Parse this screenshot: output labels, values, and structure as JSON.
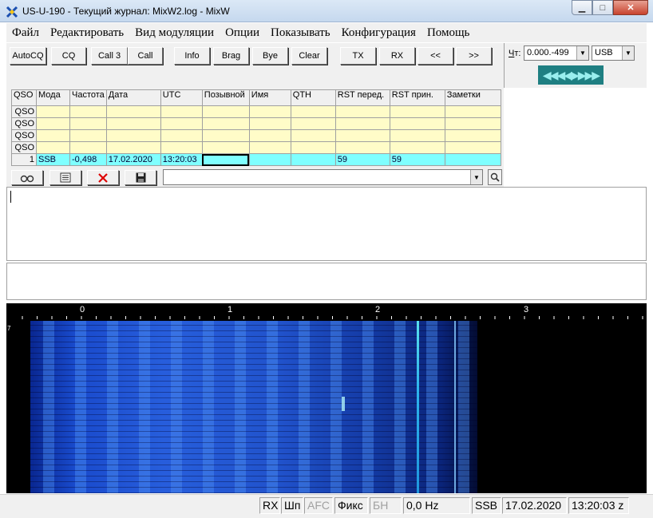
{
  "window": {
    "title": "US-U-190 - Текущий журнал: MixW2.log - MixW",
    "minimize": "▁",
    "maximize": "□",
    "close": "✕"
  },
  "menu": [
    "Файл",
    "Редактировать",
    "Вид модуляции",
    "Опции",
    "Показывать",
    "Конфигурация",
    "Помощь"
  ],
  "toolbar": {
    "buttons": [
      "AutoCQ",
      "CQ",
      "Call 3",
      "Call",
      "Info",
      "Brag",
      "Bye",
      "Clear",
      "TX",
      "RX",
      "<<",
      ">>"
    ]
  },
  "channel": {
    "label_prefix": "Ч",
    "label_suffix": "т:",
    "freq_value": "0.000.-499",
    "mode_value": "USB",
    "tuning_widget": "◀◀◀◀▶▶▶▶"
  },
  "log": {
    "headers": [
      "QSO",
      "Мода",
      "Частота",
      "Дата",
      "UTC",
      "Позывной",
      "Имя",
      "QTH",
      "RST перед.",
      "RST прин.",
      "Заметки"
    ],
    "empty_row_label": "QSO",
    "current_row": {
      "num": "1",
      "mode": "SSB",
      "freq": "-0,498",
      "date": "17.02.2020",
      "utc": "13:20:03",
      "call": "",
      "name": "",
      "qth": "",
      "rst_sent": "59",
      "rst_rcvd": "59",
      "notes": ""
    }
  },
  "logtools": {
    "search_value": ""
  },
  "waterfall": {
    "scale_labels": [
      "0",
      "1",
      "2",
      "3"
    ],
    "marker": "7"
  },
  "status": {
    "rx": "RX",
    "sp": "Шп",
    "afc": "AFC",
    "fix": "Фикс",
    "bn": "БН",
    "freq": "0,0 Hz",
    "mode": "SSB",
    "date": "17.02.2020",
    "time": "13:20:03 z"
  },
  "colors": {
    "log_yellow": "#fffcc8",
    "log_current": "#7fffff",
    "tuning_bg": "#1f7f82"
  }
}
